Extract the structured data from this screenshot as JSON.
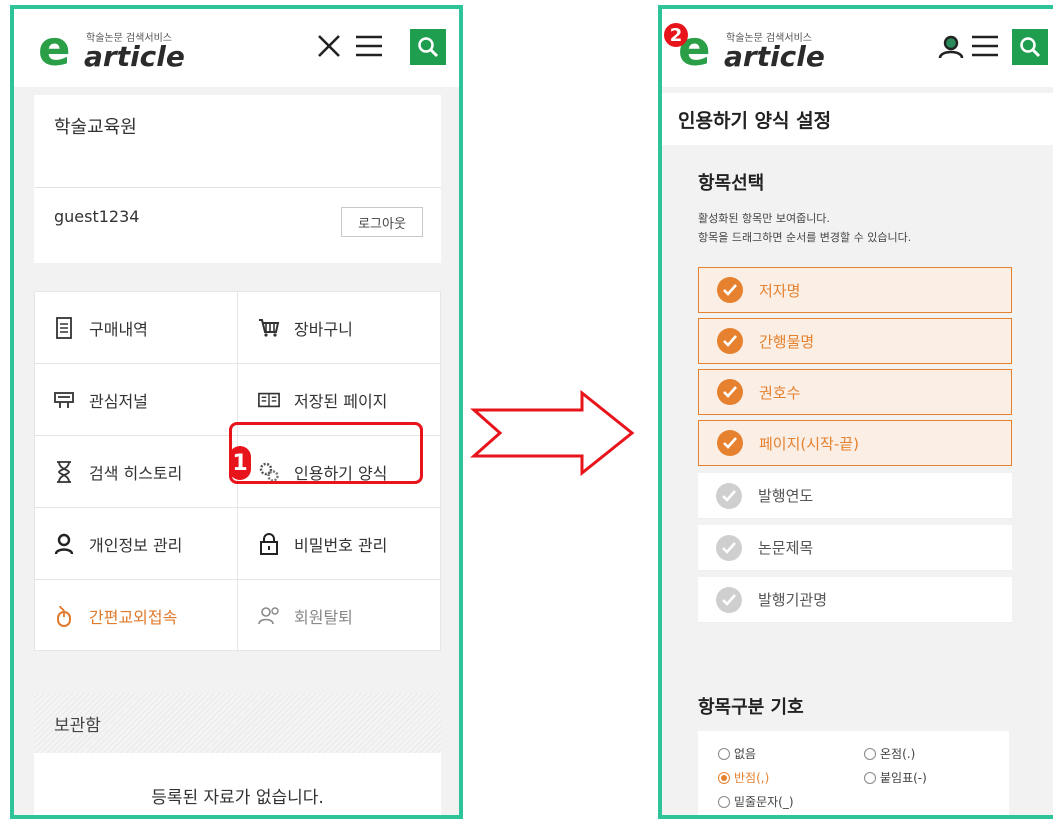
{
  "left": {
    "logo": {
      "sub": "학술논문 검색서비스",
      "word": "article"
    },
    "profile": {
      "institution": "학술교육원",
      "username": "guest1234",
      "logout_label": "로그아웃"
    },
    "menu": [
      {
        "label": "구매내역",
        "icon": "document-icon"
      },
      {
        "label": "장바구니",
        "icon": "cart-icon"
      },
      {
        "label": "관심저널",
        "icon": "journal-icon"
      },
      {
        "label": "저장된 페이지",
        "icon": "book-icon"
      },
      {
        "label": "검색 히스토리",
        "icon": "hourglass-icon"
      },
      {
        "label": "인용하기 양식",
        "icon": "gear-icon"
      },
      {
        "label": "개인정보 관리",
        "icon": "person-icon"
      },
      {
        "label": "비밀번호 관리",
        "icon": "lock-icon"
      },
      {
        "label": "간편교외접속",
        "icon": "mouse-icon"
      },
      {
        "label": "회원탈퇴",
        "icon": "member-leave-icon"
      }
    ],
    "storage": {
      "title": "보관함",
      "empty": "등록된 자료가 없습니다."
    },
    "step": "1"
  },
  "right": {
    "logo": {
      "sub": "학술논문 검색서비스",
      "word": "article"
    },
    "step": "2",
    "page_title": "인용하기 양식 설정",
    "select_title": "항목선택",
    "help_1": "활성화된 항목만 보여줍니다.",
    "help_2": "항목을 드래그하면 순서를 변경할 수 있습니다.",
    "items": [
      {
        "label": "저자명",
        "active": true
      },
      {
        "label": "간행물명",
        "active": true
      },
      {
        "label": "권호수",
        "active": true
      },
      {
        "label": "페이지(시작-끝)",
        "active": true
      },
      {
        "label": "발행연도",
        "active": false
      },
      {
        "label": "논문제목",
        "active": false
      },
      {
        "label": "발행기관명",
        "active": false
      }
    ],
    "separator_title": "항목구분 기호",
    "separators": [
      {
        "label": "없음",
        "checked": false
      },
      {
        "label": "온점(.)",
        "checked": false
      },
      {
        "label": "반점(,)",
        "checked": true
      },
      {
        "label": "붙임표(-)",
        "checked": false
      },
      {
        "label": "밑줄문자(_)",
        "checked": false
      }
    ]
  },
  "colors": {
    "frame": "#2fc39a",
    "accent": "#e6822f",
    "brand_green": "#1f9e4f",
    "callout": "#e8141b"
  }
}
